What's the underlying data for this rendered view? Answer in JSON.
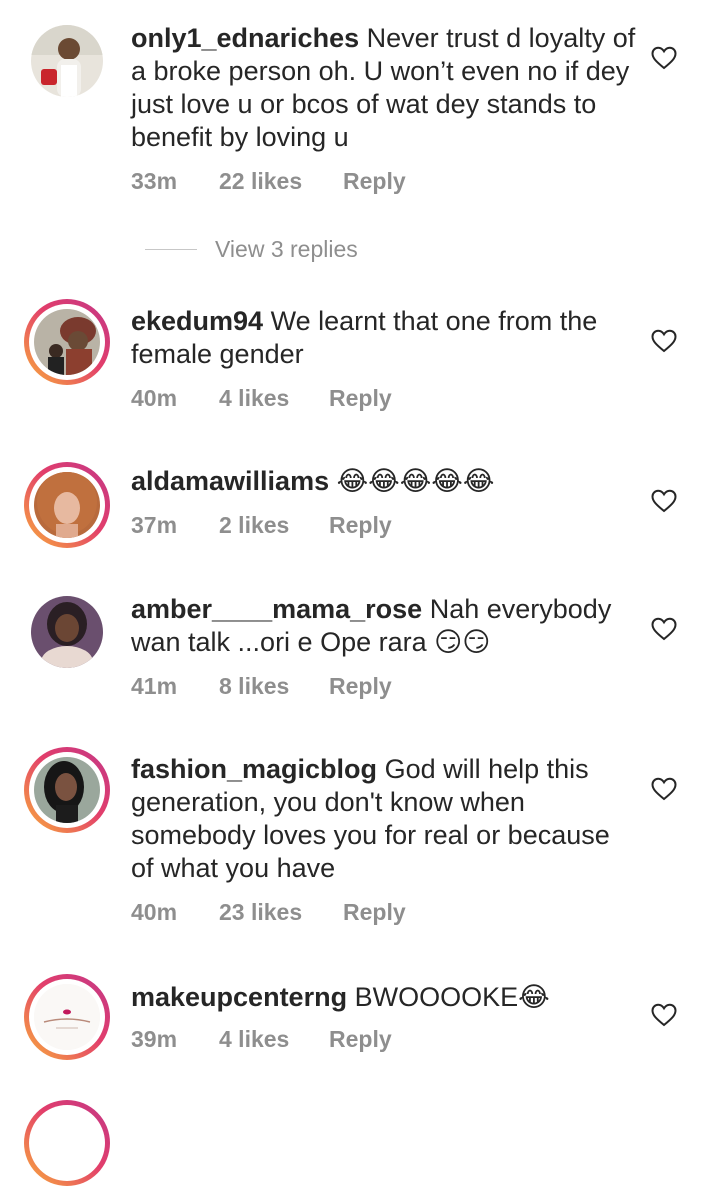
{
  "comments": [
    {
      "username": "only1_ednariches",
      "text": "Never trust d loyalty of a broke person oh. U won’t even no if dey just love u or bcos of wat dey stands to benefit by loving u",
      "time": "33m",
      "likes": "22 likes",
      "reply": "Reply"
    },
    {
      "username": "ekedum94",
      "text": "We learnt that one from the female gender",
      "time": "40m",
      "likes": "4 likes",
      "reply": "Reply"
    },
    {
      "username": "aldamawilliams",
      "text": "😂😂😂😂😂",
      "time": "37m",
      "likes": "2 likes",
      "reply": "Reply"
    },
    {
      "username": "amber____mama_rose",
      "text": "Nah everybody wan talk ...ori e Ope rara 😏😏",
      "time": "41m",
      "likes": "8 likes",
      "reply": "Reply"
    },
    {
      "username": "fashion_magicblog",
      "text": "God will help this generation, you don't know when somebody loves you for real or because of what you have",
      "time": "40m",
      "likes": "23 likes",
      "reply": "Reply"
    },
    {
      "username": "makeupcenterng",
      "text": "BWOOOOKE😂",
      "time": "39m",
      "likes": "4 likes",
      "reply": "Reply"
    }
  ],
  "view_replies": "View 3 replies",
  "icons": {
    "like": "heart-outline-icon"
  },
  "colors": {
    "text": "#262626",
    "secondary": "#8e8e8e",
    "ring_start": "#f9ae3b",
    "ring_end": "#c23788"
  }
}
